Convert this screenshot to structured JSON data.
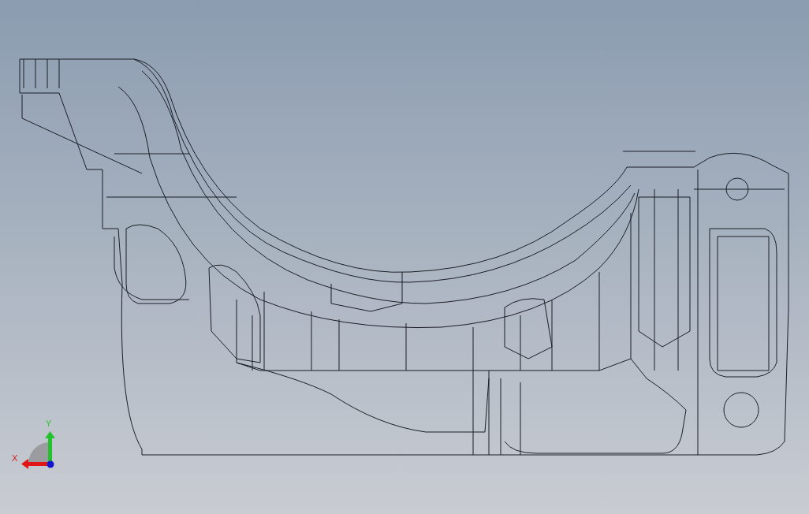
{
  "viewport": {
    "model": {
      "kind": "wireframe"
    },
    "triad": {
      "x_label": "X",
      "y_label": "Y"
    }
  }
}
